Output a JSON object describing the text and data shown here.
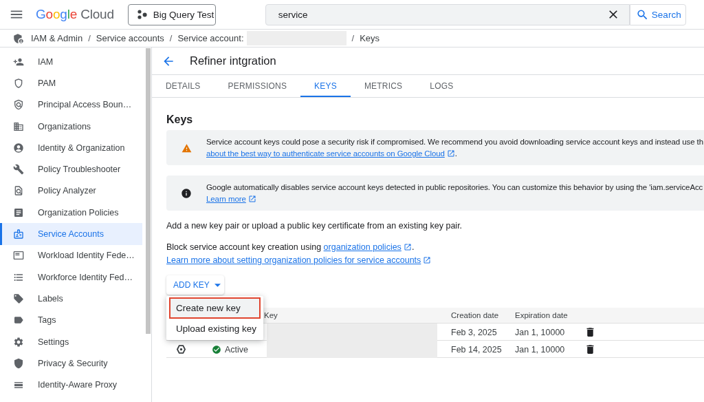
{
  "topbar": {
    "logo": "Google Cloud",
    "project": "Big Query Test",
    "search": {
      "value": "service"
    },
    "search_button": "Search"
  },
  "breadcrumb": {
    "items": [
      {
        "label": "IAM & Admin",
        "redacted": false
      },
      {
        "label": "Service accounts",
        "redacted": false
      },
      {
        "label": "Service account:",
        "redacted": true
      },
      {
        "label": "Keys",
        "redacted": false
      }
    ],
    "separators": [
      "/",
      "/",
      "/"
    ]
  },
  "sidebar": {
    "items": [
      {
        "label": "IAM",
        "selected": false
      },
      {
        "label": "PAM",
        "selected": false
      },
      {
        "label": "Principal Access Boun…",
        "selected": false
      },
      {
        "label": "Organizations",
        "selected": false
      },
      {
        "label": "Identity & Organization",
        "selected": false
      },
      {
        "label": "Policy Troubleshooter",
        "selected": false
      },
      {
        "label": "Policy Analyzer",
        "selected": false
      },
      {
        "label": "Organization Policies",
        "selected": false
      },
      {
        "label": "Service Accounts",
        "selected": true
      },
      {
        "label": "Workload Identity Fede…",
        "selected": false
      },
      {
        "label": "Workforce Identity Fed…",
        "selected": false
      },
      {
        "label": "Labels",
        "selected": false
      },
      {
        "label": "Tags",
        "selected": false
      },
      {
        "label": "Settings",
        "selected": false
      },
      {
        "label": "Privacy & Security",
        "selected": false
      },
      {
        "label": "Identity-Aware Proxy",
        "selected": false
      }
    ]
  },
  "page": {
    "title": "Refiner intgration"
  },
  "tabs": [
    {
      "label": "DETAILS",
      "selected": false
    },
    {
      "label": "PERMISSIONS",
      "selected": false
    },
    {
      "label": "KEYS",
      "selected": true
    },
    {
      "label": "METRICS",
      "selected": false
    },
    {
      "label": "LOGS",
      "selected": false
    }
  ],
  "keys_section": {
    "heading": "Keys",
    "alerts": [
      {
        "kind": "warning",
        "text": "Service account keys could pose a security risk if compromised. We recommend you avoid downloading service account keys and instead use th",
        "link": "about the best way to authenticate service accounts on Google Cloud",
        "suffix": "."
      },
      {
        "kind": "info",
        "text": "Google automatically disables service account keys detected in public repositories. You can customize this behavior by using the 'iam.serviceAcc",
        "link": "Learn more"
      }
    ],
    "description": "Add a new key pair or upload a public key certificate from an existing key pair.",
    "policy_note": {
      "text": "Block service account key creation using",
      "link": "organization policies",
      "suffix": "."
    },
    "learn_more_link": "Learn more about setting organization policies for service accounts",
    "add_key_button": {
      "label": "ADD KEY",
      "expanded": true
    },
    "menu": [
      {
        "label": "Create new key",
        "highlighted": true
      },
      {
        "label": "Upload existing key",
        "highlighted": false
      }
    ]
  },
  "table": {
    "columns": [
      "Key",
      "Creation date",
      "Expiration date"
    ],
    "rows": [
      {
        "key_hidden": true,
        "creation_date": "Feb 3, 2025",
        "expiration_date": "Jan 1, 10000"
      },
      {
        "status": "Active",
        "key_hidden": true,
        "creation_date": "Feb 14, 2025",
        "expiration_date": "Jan 1, 10000"
      }
    ]
  }
}
